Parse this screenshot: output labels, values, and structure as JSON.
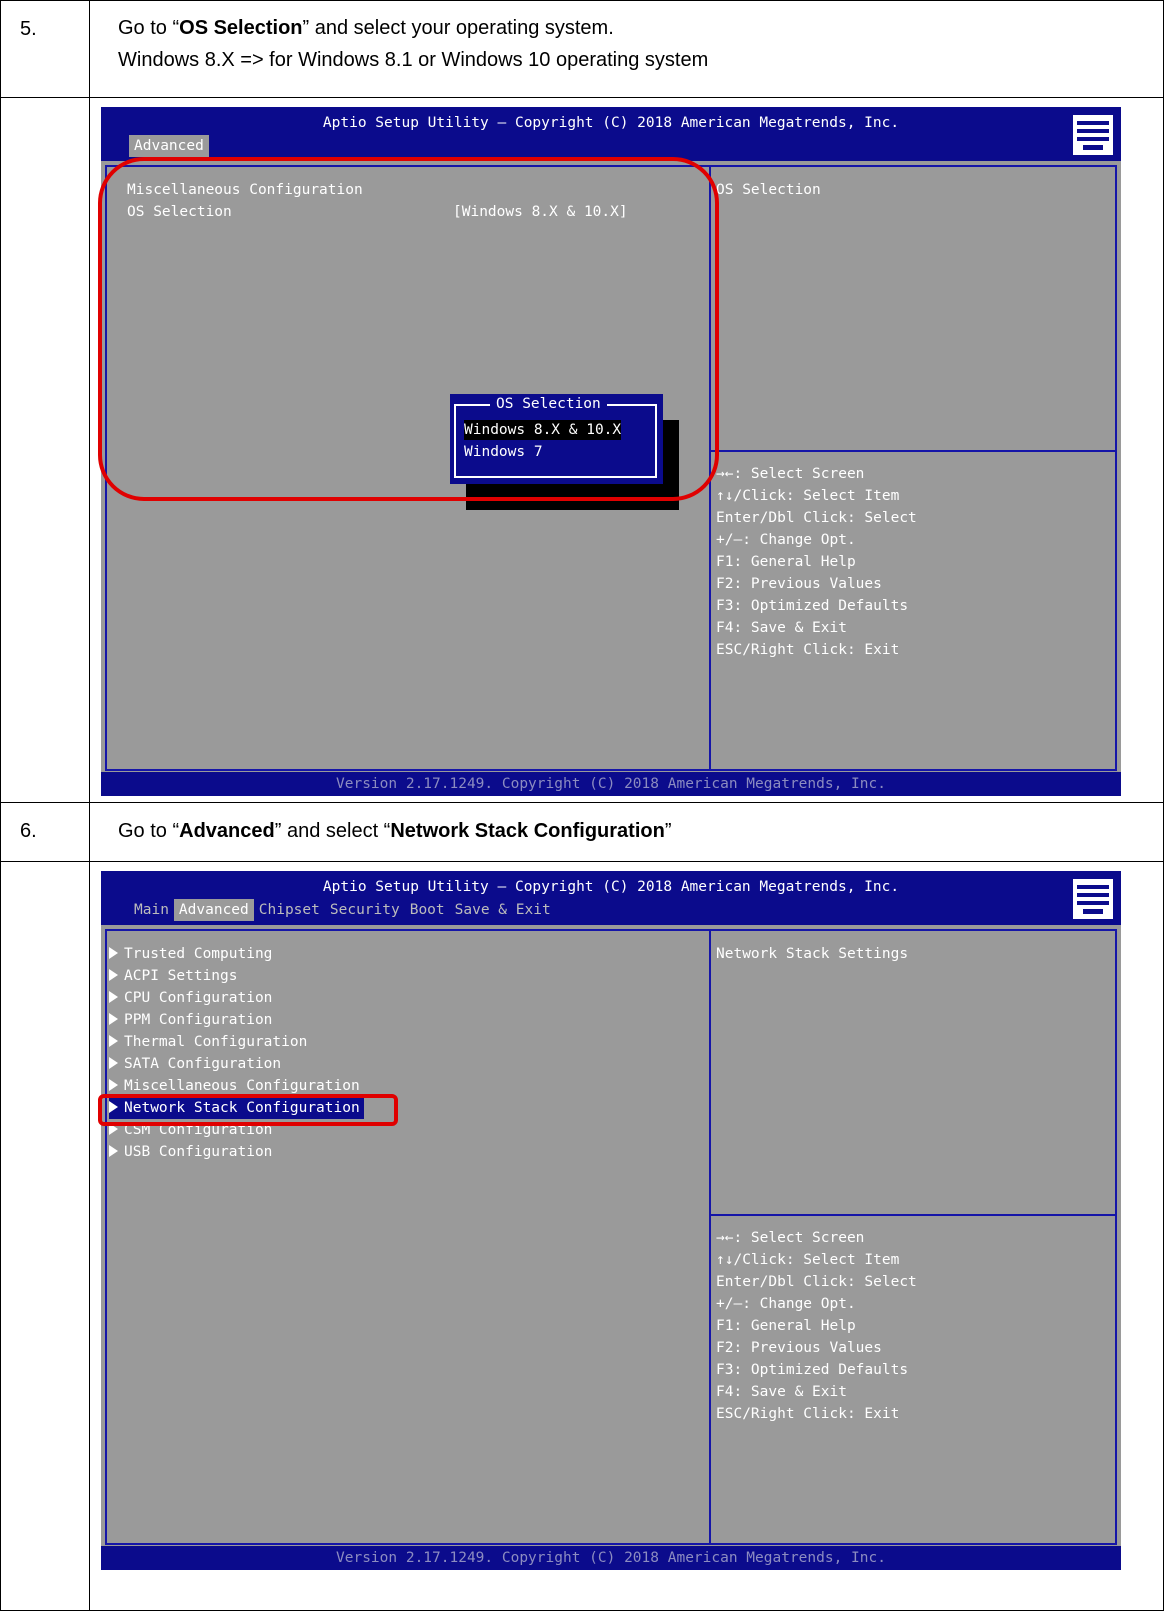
{
  "steps": [
    {
      "number": "5.",
      "instruction_line1_pre": "Go to “",
      "instruction_line1_bold": "OS Selection",
      "instruction_line1_post": "” and select your operating system.",
      "instruction_line2": "Windows 8.X  => for Windows 8.1 or Windows 10 operating system"
    },
    {
      "number": "6.",
      "instruction_pre": "Go to “",
      "instruction_bold1": "Advanced",
      "instruction_mid": "” and select “",
      "instruction_bold2": "Network Stack Configuration",
      "instruction_post": "”"
    }
  ],
  "bios_common": {
    "title": "Aptio Setup Utility – Copyright (C) 2018 American Megatrends, Inc.",
    "footer": "Version 2.17.1249. Copyright (C) 2018 American Megatrends, Inc.",
    "help_keys": [
      "→←: Select Screen",
      "↑↓/Click: Select Item",
      "Enter/Dbl Click: Select",
      "+/–: Change Opt.",
      "F1: General Help",
      "F2: Previous Values",
      "F3: Optimized Defaults",
      "F4: Save & Exit",
      "ESC/Right Click: Exit"
    ],
    "colors": {
      "bios_blue": "#0b0b8c",
      "bios_gray": "#9a9a9a",
      "highlight_red": "#e00000"
    }
  },
  "screen1": {
    "active_tab": "Advanced",
    "section_heading": "Miscellaneous Configuration",
    "setting_label": "OS Selection",
    "setting_value": "[Windows 8.X & 10.X]",
    "help_text": "OS Selection",
    "popup": {
      "title": "OS Selection",
      "options": [
        "Windows 8.X & 10.X",
        "Windows 7"
      ],
      "selected_index": 0
    }
  },
  "screen2": {
    "tabs": [
      "Main",
      "Advanced",
      "Chipset",
      "Security",
      "Boot",
      "Save & Exit"
    ],
    "active_tab_index": 1,
    "menu_items": [
      "Trusted Computing",
      "ACPI Settings",
      "CPU Configuration",
      "PPM Configuration",
      "Thermal Configuration",
      "SATA Configuration",
      "Miscellaneous Configuration",
      "Network Stack Configuration",
      "CSM Configuration",
      "USB Configuration"
    ],
    "selected_item_index": 7,
    "help_text": "Network Stack Settings"
  }
}
